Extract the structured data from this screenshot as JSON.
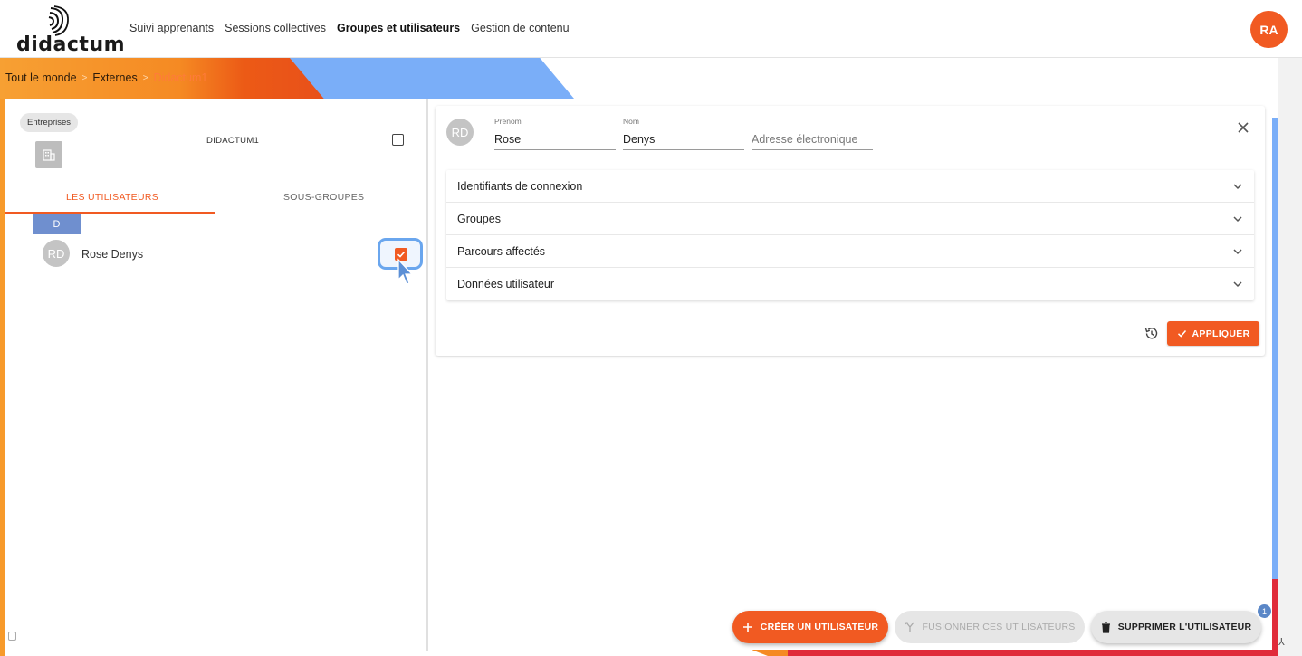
{
  "app": {
    "logo_text": "didactum",
    "user_initials": "RA"
  },
  "nav": [
    {
      "label": "Suivi apprenants",
      "active": false
    },
    {
      "label": "Sessions collectives",
      "active": false
    },
    {
      "label": "Groupes et utilisateurs",
      "active": true
    },
    {
      "label": "Gestion de contenu",
      "active": false
    }
  ],
  "breadcrumb": {
    "items": [
      "Tout le monde",
      "Externes"
    ],
    "current": "Didactum1",
    "separator": ">"
  },
  "left_panel": {
    "chip": "Entreprises",
    "group_name": "DIDACTUM1",
    "tabs": {
      "users": "LES UTILISATEURS",
      "subgroups": "SOUS-GROUPES"
    },
    "letter": "D",
    "user": {
      "initials": "RD",
      "name": "Rose Denys",
      "checked": true
    }
  },
  "detail": {
    "initials": "RD",
    "first_name_label": "Prénom",
    "first_name": "Rose",
    "last_name_label": "Nom",
    "last_name": "Denys",
    "email_placeholder": "Adresse électronique",
    "sections": [
      "Identifiants de connexion",
      "Groupes",
      "Parcours affectés",
      "Données utilisateur"
    ],
    "apply_label": "APPLIQUER"
  },
  "actions": {
    "create": "CRÉER UN UTILISATEUR",
    "merge": "FUSIONNER CES UTILISATEURS",
    "delete": "SUPPRIMER L'UTILISATEUR",
    "badge": "1"
  },
  "colors": {
    "accent": "#f15a22",
    "blue": "#7aaef8",
    "letter_header": "#6f8fcf"
  },
  "icons": [
    "logo-mark-icon",
    "building-icon",
    "check-icon",
    "cursor-icon",
    "close-icon",
    "chevron-down-icon",
    "history-icon",
    "plus-icon",
    "merge-icon",
    "trash-icon"
  ]
}
